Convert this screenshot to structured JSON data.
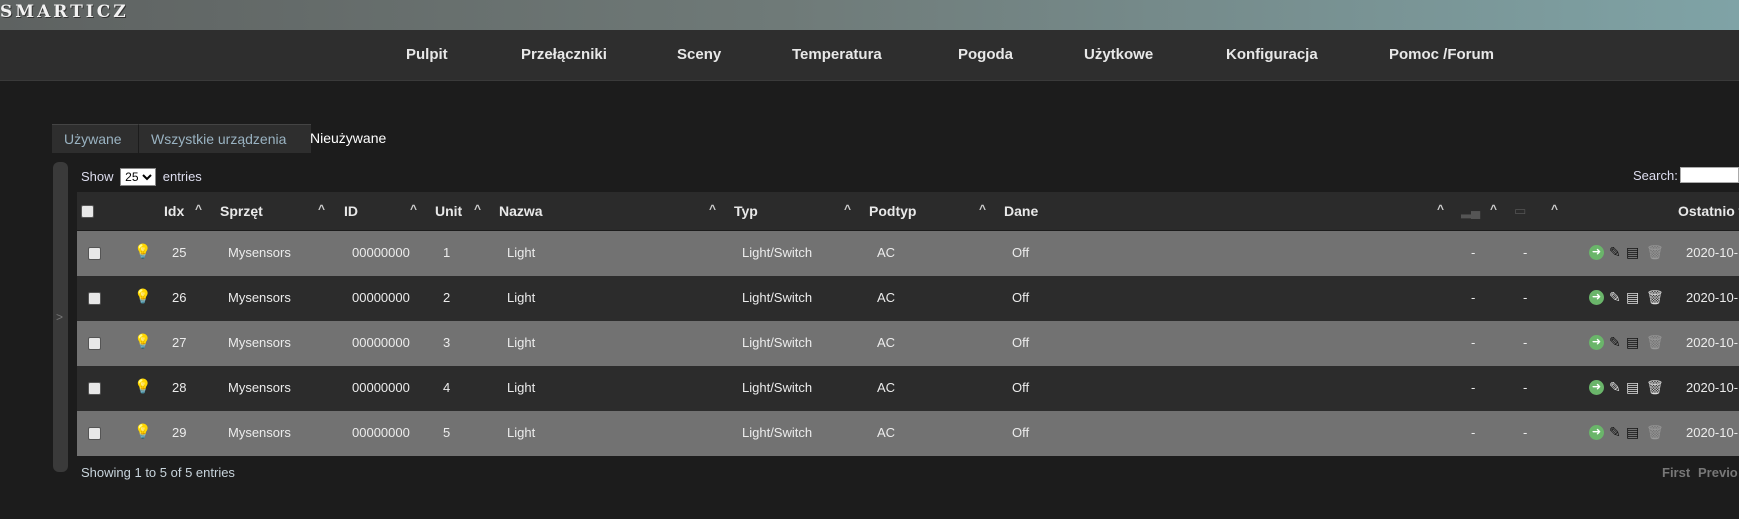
{
  "app": {
    "logo": "SMARTICZ"
  },
  "nav": [
    "Pulpit",
    "Przełączniki",
    "Sceny",
    "Temperatura",
    "Pogoda",
    "Użytkowe",
    "Konfiguracja",
    "Pomoc /Forum"
  ],
  "tabs": [
    {
      "label": "Używane",
      "active": false
    },
    {
      "label": "Wszystkie urządzenia",
      "active": false
    },
    {
      "label": "Nieużywane",
      "active": true
    }
  ],
  "table_controls": {
    "show_label": "Show",
    "length_value": "25",
    "entries_label": "entries",
    "search_label": "Search:"
  },
  "columns": [
    "Idx",
    "Sprzęt",
    "ID",
    "Unit",
    "Nazwa",
    "Typ",
    "Podtyp",
    "Dane",
    "Ostatnio w"
  ],
  "rows": [
    {
      "idx": "25",
      "hardware": "Mysensors",
      "id": "00000000",
      "unit": "1",
      "name": "Light",
      "type": "Light/Switch",
      "subtype": "AC",
      "data": "Off",
      "signal": "-",
      "battery": "-",
      "last_seen": "2020-10-"
    },
    {
      "idx": "26",
      "hardware": "Mysensors",
      "id": "00000000",
      "unit": "2",
      "name": "Light",
      "type": "Light/Switch",
      "subtype": "AC",
      "data": "Off",
      "signal": "-",
      "battery": "-",
      "last_seen": "2020-10-"
    },
    {
      "idx": "27",
      "hardware": "Mysensors",
      "id": "00000000",
      "unit": "3",
      "name": "Light",
      "type": "Light/Switch",
      "subtype": "AC",
      "data": "Off",
      "signal": "-",
      "battery": "-",
      "last_seen": "2020-10-"
    },
    {
      "idx": "28",
      "hardware": "Mysensors",
      "id": "00000000",
      "unit": "4",
      "name": "Light",
      "type": "Light/Switch",
      "subtype": "AC",
      "data": "Off",
      "signal": "-",
      "battery": "-",
      "last_seen": "2020-10-"
    },
    {
      "idx": "29",
      "hardware": "Mysensors",
      "id": "00000000",
      "unit": "5",
      "name": "Light",
      "type": "Light/Switch",
      "subtype": "AC",
      "data": "Off",
      "signal": "-",
      "battery": "-",
      "last_seen": "2020-10-"
    }
  ],
  "footer": {
    "info": "Showing 1 to 5 of 5 entries",
    "first": "First",
    "previous": "Previo"
  },
  "icons": {
    "row_type": "lightbulb-icon",
    "actions": [
      "add-device-icon",
      "edit-icon",
      "log-icon",
      "delete-icon"
    ]
  },
  "colors": {
    "accent_green": "#6ab56a",
    "row_light": "#727272",
    "row_dark": "#2c2c2c"
  }
}
